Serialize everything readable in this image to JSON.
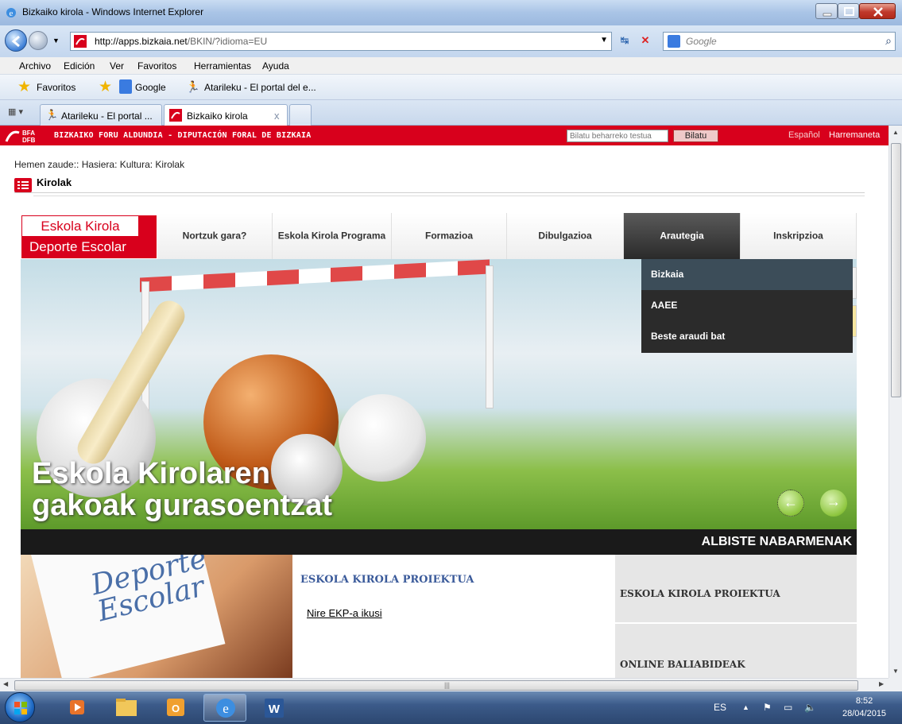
{
  "window": {
    "title": "Bizkaiko kirola - Windows Internet Explorer",
    "url_host": "http://apps.bizkaia.net",
    "url_path": "/BKIN/?idioma=EU",
    "search_placeholder": "Google"
  },
  "menubar": [
    "Archivo",
    "Edición",
    "Ver",
    "Favoritos",
    "Herramientas",
    "Ayuda"
  ],
  "favbar": {
    "favorites_label": "Favoritos",
    "items": [
      "Google",
      "Atarileku - El portal del e..."
    ]
  },
  "tabs": [
    {
      "label": "Atarileku - El portal ..."
    },
    {
      "label": "Bizkaiko kirola"
    }
  ],
  "site": {
    "org_name": "BIZKAIKO FORU ALDUNDIA - DIPUTACIÓN FORAL DE BIZKAIA",
    "search_placeholder": "Bilatu beharreko testua",
    "search_button": "Bilatu",
    "lang_link": "Español",
    "contact_link": "Harremaneta"
  },
  "breadcrumb": "Hemen zaude:: Hasiera: Kultura: Kirolak",
  "section_title": "Kirolak",
  "portal": {
    "logo_top": "Eskola Kirola",
    "logo_bottom": "Deporte Escolar",
    "menu": [
      {
        "label": "Nortzuk gara?"
      },
      {
        "label": "Eskola Kirola Programa"
      },
      {
        "label": "Formazioa"
      },
      {
        "label": "Dibulgazioa"
      },
      {
        "label": "Arautegia"
      },
      {
        "label": "Inskripzioa"
      }
    ],
    "dropdown": [
      "Bizkaia",
      "AAEE",
      "Beste araudi bat"
    ],
    "hero_caption_line1": "Eskola Kirolaren",
    "hero_caption_line2": "gakoak gurasoentzat",
    "news_header": "ALBISTE NABARMENAK",
    "news_image_text": "Deporte Escolar",
    "news_title": "ESKOLA KIROLA PROIEKTUA",
    "news_link": "Nire EKP-a ikusi",
    "side_items": [
      "ESKOLA KIROLA PROIEKTUA",
      "ONLINE BALIABIDEAK"
    ]
  },
  "taskbar": {
    "lang": "ES",
    "time": "8:52",
    "date": "28/04/2015"
  }
}
